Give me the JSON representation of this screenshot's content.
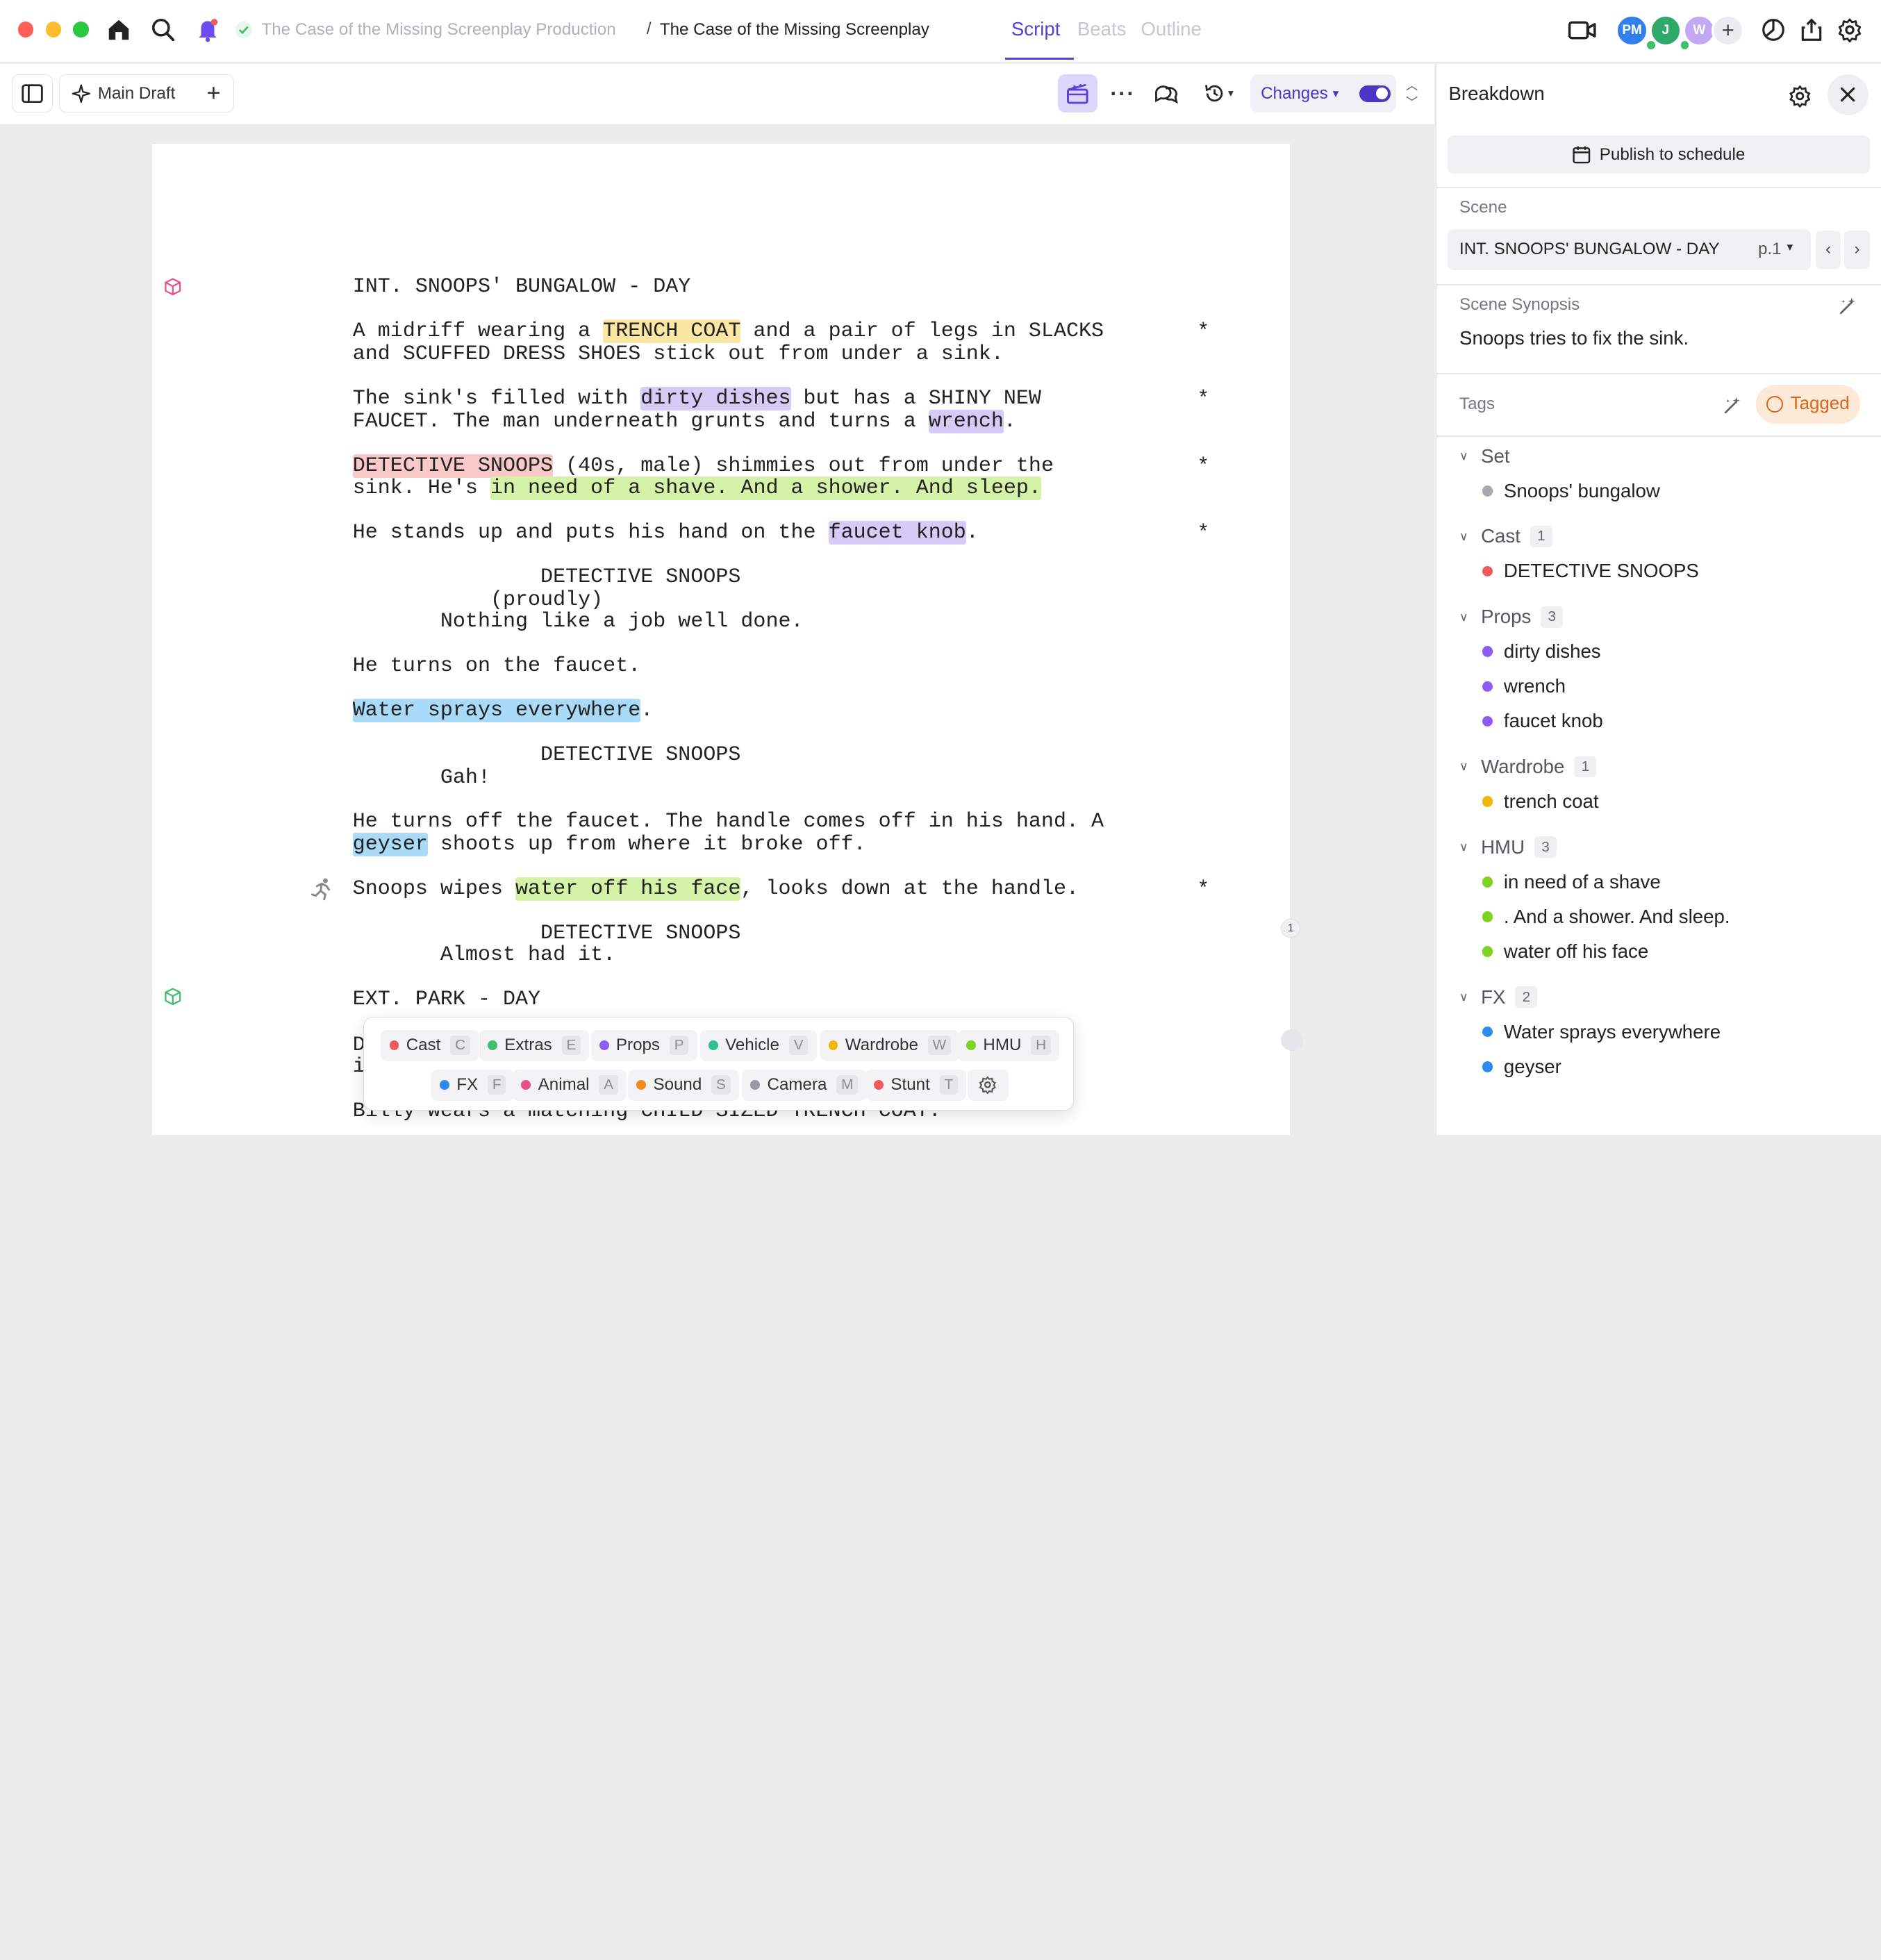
{
  "topbar": {
    "breadcrumb_parent": "The Case of the Missing Screenplay Production",
    "breadcrumb_separator": "/",
    "breadcrumb_current": "The Case of the Missing Screenplay",
    "tabs": [
      {
        "label": "Script",
        "active": true
      },
      {
        "label": "Beats",
        "active": false
      },
      {
        "label": "Outline",
        "active": false
      }
    ],
    "avatars": [
      {
        "initials": "PM",
        "color": "#2f80ed"
      },
      {
        "initials": "J",
        "color": "#2fa96a"
      },
      {
        "initials": "W",
        "color": "#c4a8f5"
      }
    ],
    "accent_color": "#5b3fd6"
  },
  "toolbar": {
    "draft_label": "Main Draft",
    "changes_label": "Changes"
  },
  "script": {
    "lines": [
      {
        "segs": [
          {
            "t": "INT. SNOOPS' BUNGALOW - DAY"
          }
        ]
      },
      {
        "segs": [
          {
            "t": "A midriff wearing a "
          },
          {
            "t": "TRENCH COAT",
            "c": "wardrobe"
          },
          {
            "t": " and a pair of legs in SLACKS"
          }
        ],
        "star": "*"
      },
      {
        "segs": [
          {
            "t": "and SCUFFED DRESS SHOES stick out from under a sink."
          }
        ]
      },
      {
        "segs": [
          {
            "t": "The sink's filled with "
          },
          {
            "t": "dirty dishes",
            "c": "props"
          },
          {
            "t": " but has a SHINY NEW"
          }
        ],
        "star": "*"
      },
      {
        "segs": [
          {
            "t": "FAUCET. The man underneath grunts and turns a "
          },
          {
            "t": "wrench",
            "c": "props"
          },
          {
            "t": "."
          }
        ]
      },
      {
        "segs": [
          {
            "t": "DETECTIVE SNOOPS",
            "c": "cast"
          },
          {
            "t": " (40s, male) shimmies out from under the"
          }
        ],
        "star": "*"
      },
      {
        "segs": [
          {
            "t": "sink. He's "
          },
          {
            "t": "in need of a shave. And a shower. And sleep.",
            "c": "hmu"
          }
        ]
      },
      {
        "segs": [
          {
            "t": "He stands up and puts his hand on the "
          },
          {
            "t": "faucet knob",
            "c": "props"
          },
          {
            "t": "."
          }
        ],
        "star": "*"
      },
      {
        "segs": [
          {
            "t": "               DETECTIVE SNOOPS"
          }
        ]
      },
      {
        "segs": [
          {
            "t": "           (proudly)"
          }
        ]
      },
      {
        "segs": [
          {
            "t": "       Nothing like a job well done."
          }
        ]
      },
      {
        "segs": [
          {
            "t": "He turns on the faucet."
          }
        ]
      },
      {
        "segs": [
          {
            "t": "Water sprays everywhere",
            "c": "fx"
          },
          {
            "t": "."
          }
        ]
      },
      {
        "segs": [
          {
            "t": "               DETECTIVE SNOOPS"
          }
        ]
      },
      {
        "segs": [
          {
            "t": "       Gah!"
          }
        ]
      },
      {
        "segs": [
          {
            "t": "He turns off the faucet. The handle comes off in his hand. A"
          }
        ]
      },
      {
        "segs": [
          {
            "t": "geyser",
            "c": "fx"
          },
          {
            "t": " shoots up from where it broke off."
          }
        ]
      },
      {
        "segs": [
          {
            "t": "Snoops wipes "
          },
          {
            "t": "water off his face",
            "c": "hmu"
          },
          {
            "t": ", looks down at the handle."
          }
        ],
        "star": "*"
      },
      {
        "segs": [
          {
            "t": "               DETECTIVE SNOOPS"
          }
        ]
      },
      {
        "segs": [
          {
            "t": "       Almost had it."
          }
        ]
      },
      {
        "segs": [
          {
            "t": "EXT. PARK - DAY"
          }
        ]
      },
      {
        "segs": [
          {
            "t": "D                                               noops"
          }
        ]
      },
      {
        "segs": [
          {
            "t": "i"
          }
        ]
      },
      {
        "segs": [
          {
            "t": "Billy wears a matching CHILD SIZED TRENCH COAT."
          }
        ]
      }
    ],
    "comment_count": "1"
  },
  "tag_menu": {
    "row1": [
      {
        "label": "Cast",
        "key": "C",
        "color": "#ef5b5b"
      },
      {
        "label": "Extras",
        "key": "E",
        "color": "#3fbf6a"
      },
      {
        "label": "Props",
        "key": "P",
        "color": "#8b5cf6"
      },
      {
        "label": "Vehicle",
        "key": "V",
        "color": "#2fbf8f"
      },
      {
        "label": "Wardrobe",
        "key": "W",
        "color": "#f2b705"
      },
      {
        "label": "HMU",
        "key": "H",
        "color": "#7ed321"
      }
    ],
    "row2": [
      {
        "label": "FX",
        "key": "F",
        "color": "#2d8cf0"
      },
      {
        "label": "Animal",
        "key": "A",
        "color": "#e8508a"
      },
      {
        "label": "Sound",
        "key": "S",
        "color": "#f28c1e"
      },
      {
        "label": "Camera",
        "key": "M",
        "color": "#9a9aa2"
      },
      {
        "label": "Stunt",
        "key": "T",
        "color": "#ef5b5b"
      }
    ]
  },
  "breakdown": {
    "title": "Breakdown",
    "publish_label": "Publish to schedule",
    "scene_label": "Scene",
    "scene_value": "INT. SNOOPS' BUNGALOW - DAY",
    "scene_page": "p.1",
    "synopsis_label": "Scene Synopsis",
    "synopsis_text": "Snoops tries to fix the sink.",
    "tags_label": "Tags",
    "tagged_label": "Tagged",
    "groups": [
      {
        "name": "Set",
        "count": "",
        "items": [
          {
            "label": "Snoops' bungalow",
            "color": "#a8a8b0"
          }
        ]
      },
      {
        "name": "Cast",
        "count": "1",
        "items": [
          {
            "label": "DETECTIVE SNOOPS",
            "color": "#ef5b5b"
          }
        ]
      },
      {
        "name": "Props",
        "count": "3",
        "items": [
          {
            "label": "dirty dishes",
            "color": "#8b5cf6"
          },
          {
            "label": "wrench",
            "color": "#8b5cf6"
          },
          {
            "label": "faucet knob",
            "color": "#8b5cf6"
          }
        ]
      },
      {
        "name": "Wardrobe",
        "count": "1",
        "items": [
          {
            "label": "trench coat",
            "color": "#f2b705"
          }
        ]
      },
      {
        "name": "HMU",
        "count": "3",
        "items": [
          {
            "label": "in need of a shave",
            "color": "#7ed321"
          },
          {
            "label": ". And a shower. And sleep.",
            "color": "#7ed321"
          },
          {
            "label": "water off his face",
            "color": "#7ed321"
          }
        ]
      },
      {
        "name": "FX",
        "count": "2",
        "items": [
          {
            "label": "Water sprays everywhere",
            "color": "#2d8cf0"
          },
          {
            "label": "geyser",
            "color": "#2d8cf0"
          }
        ]
      }
    ]
  }
}
